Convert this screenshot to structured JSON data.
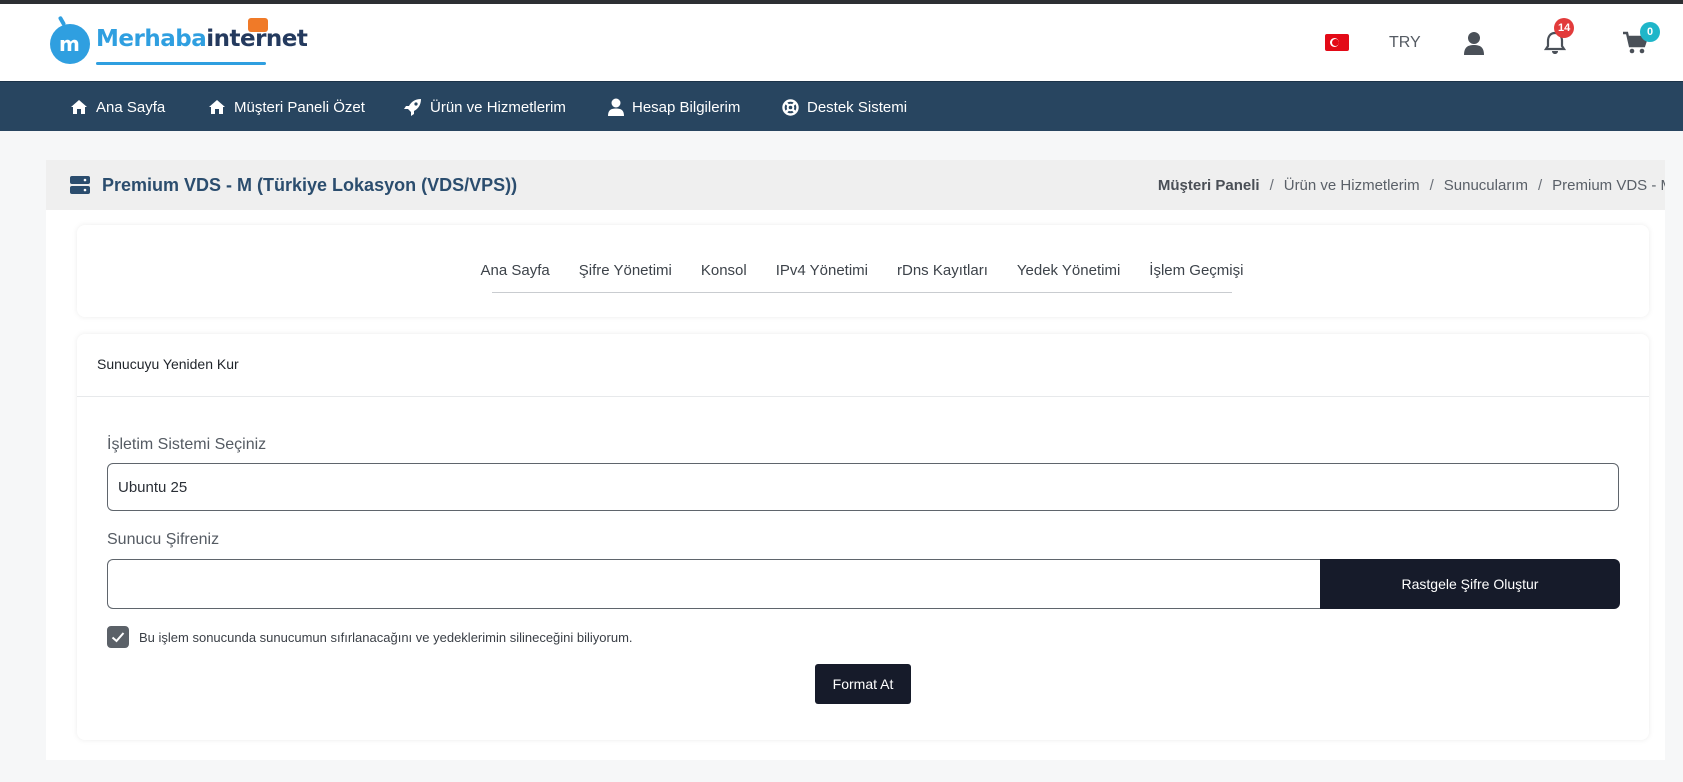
{
  "logo": {
    "mark": "m",
    "name_part1": "Merhaba",
    "name_part2": "internet"
  },
  "header": {
    "currency": "TRY",
    "notifications_count": "14",
    "cart_count": "0"
  },
  "nav": {
    "items": [
      {
        "label": "Ana Sayfa",
        "icon": "home-icon"
      },
      {
        "label": "Müşteri Paneli Özet",
        "icon": "home-icon"
      },
      {
        "label": "Ürün ve Hizmetlerim",
        "icon": "rocket-icon"
      },
      {
        "label": "Hesap Bilgilerim",
        "icon": "user-icon"
      },
      {
        "label": "Destek Sistemi",
        "icon": "lifebuoy-icon"
      }
    ]
  },
  "page": {
    "title": "Premium VDS - M (Türkiye Lokasyon (VDS/VPS))",
    "breadcrumb": [
      "Müşteri Paneli",
      "Ürün ve Hizmetlerim",
      "Sunucularım",
      "Premium VDS - M"
    ],
    "breadcrumb_sep": "/"
  },
  "tabs": [
    "Ana Sayfa",
    "Şifre Yönetimi",
    "Konsol",
    "IPv4 Yönetimi",
    "rDns Kayıtları",
    "Yedek Yönetimi",
    "İşlem Geçmişi"
  ],
  "form": {
    "card_title": "Sunucuyu Yeniden Kur",
    "os_label": "İşletim Sistemi Seçiniz",
    "os_value": "Ubuntu 25",
    "password_label": "Sunucu Şifreniz",
    "password_value": "",
    "generate_button": "Rastgele Şifre Oluştur",
    "confirm_checked": true,
    "confirm_text": "Bu işlem sonucunda sunucumun sıfırlanacağını ve yedeklerimin silineceğini biliyorum.",
    "submit_button": "Format At"
  },
  "colors": {
    "navbar": "#284560",
    "title": "#2b4d6e",
    "button": "#161b2a",
    "badge_red": "#e23b3b",
    "badge_teal": "#1fb6c9",
    "logo_blue": "#2f9fe0"
  }
}
